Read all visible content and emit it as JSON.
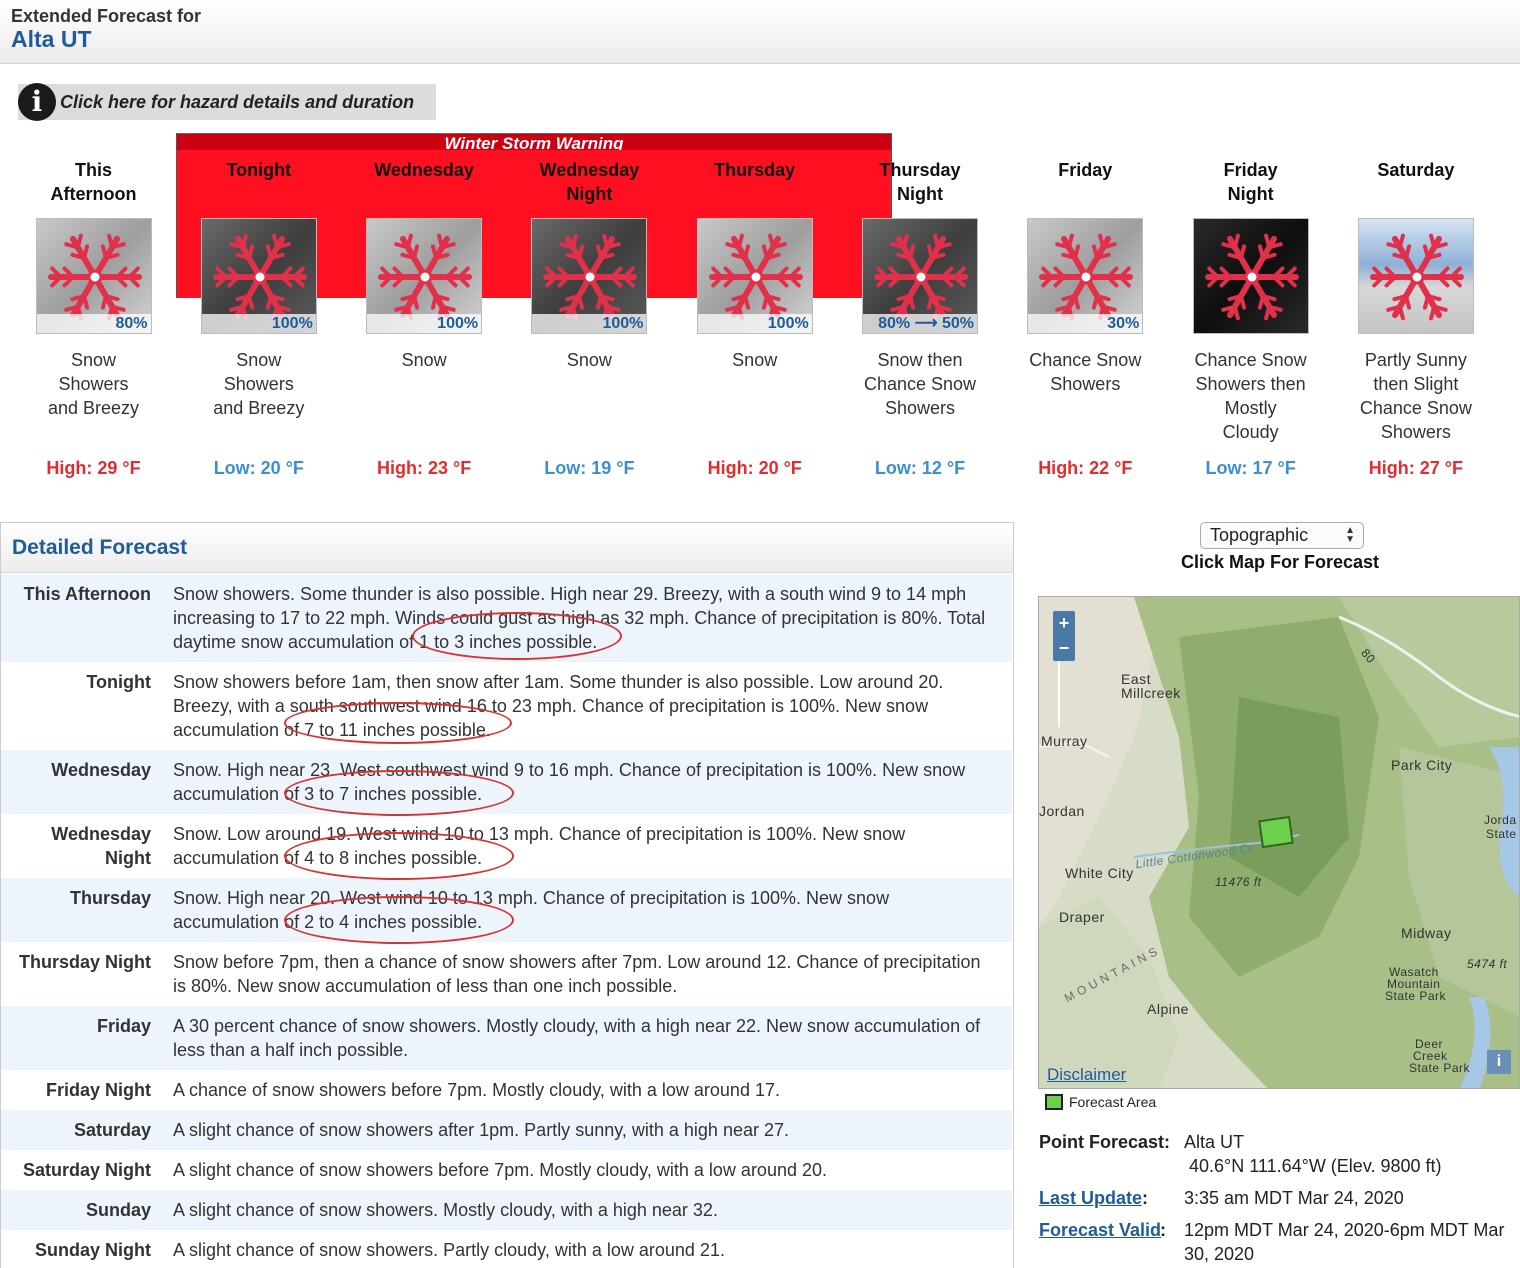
{
  "header": {
    "pre_title": "Extended Forecast for",
    "location": "Alta UT"
  },
  "hazard": {
    "icon": "info-icon",
    "label": "Click here for hazard details and duration"
  },
  "warning": {
    "label": "Winter Storm Warning",
    "color": "#ff0f1f"
  },
  "periods": [
    {
      "name_l1": "This",
      "name_l2": "Afternoon",
      "pop": "80%",
      "sky": "light",
      "desc": [
        "Snow",
        "Showers",
        "and Breezy",
        ""
      ],
      "temp": "High: 29 °F",
      "kind": "hi"
    },
    {
      "name_l1": "Tonight",
      "name_l2": "",
      "pop": "100%",
      "sky": "dark",
      "desc": [
        "Snow",
        "Showers",
        "and Breezy",
        ""
      ],
      "temp": "Low: 20 °F",
      "kind": "lo"
    },
    {
      "name_l1": "Wednesday",
      "name_l2": "",
      "pop": "100%",
      "sky": "light",
      "desc": [
        "Snow",
        "",
        "",
        ""
      ],
      "temp": "High: 23 °F",
      "kind": "hi"
    },
    {
      "name_l1": "Wednesday",
      "name_l2": "Night",
      "pop": "100%",
      "sky": "dark",
      "desc": [
        "Snow",
        "",
        "",
        ""
      ],
      "temp": "Low: 19 °F",
      "kind": "lo"
    },
    {
      "name_l1": "Thursday",
      "name_l2": "",
      "pop": "100%",
      "sky": "light",
      "desc": [
        "Snow",
        "",
        "",
        ""
      ],
      "temp": "High: 20 °F",
      "kind": "hi"
    },
    {
      "name_l1": "Thursday",
      "name_l2": "Night",
      "pop": "80% ⟶ 50%",
      "sky": "dark",
      "desc": [
        "Snow then",
        "Chance Snow",
        "Showers",
        ""
      ],
      "temp": "Low: 12 °F",
      "kind": "lo"
    },
    {
      "name_l1": "Friday",
      "name_l2": "",
      "pop": "30%",
      "sky": "light",
      "desc": [
        "Chance Snow",
        "Showers",
        "",
        ""
      ],
      "temp": "High: 22 °F",
      "kind": "hi"
    },
    {
      "name_l1": "Friday",
      "name_l2": "Night",
      "pop": "",
      "sky": "night",
      "desc": [
        "Chance Snow",
        "Showers then",
        "Mostly",
        "Cloudy"
      ],
      "temp": "Low: 17 °F",
      "kind": "lo"
    },
    {
      "name_l1": "Saturday",
      "name_l2": "",
      "pop": "",
      "sky": "sky",
      "desc": [
        "Partly Sunny",
        "then Slight",
        "Chance Snow",
        "Showers"
      ],
      "temp": "High: 27 °F",
      "kind": "hi"
    }
  ],
  "detailed": {
    "title": "Detailed Forecast",
    "rows": [
      {
        "label": [
          "This Afternoon"
        ],
        "lines": [
          "Snow showers. Some thunder is also possible. High near 29. Breezy, with a south wind 9 to 14 mph",
          "increasing to 17 to 22 mph. Winds could gust as high as 32 mph. Chance of precipitation is 80%. Total",
          "daytime snow accumulation of 1 to 3 inches possible."
        ]
      },
      {
        "label": [
          "Tonight"
        ],
        "lines": [
          "Snow showers before 1am, then snow after 1am. Some thunder is also possible. Low around 20.",
          "Breezy, with a south southwest wind 16 to 23 mph. Chance of precipitation is 100%. New snow",
          "accumulation of 7 to 11 inches possible."
        ]
      },
      {
        "label": [
          "Wednesday"
        ],
        "lines": [
          "Snow. High near 23. West southwest wind 9 to 16 mph. Chance of precipitation is 100%. New snow",
          "accumulation of 3 to 7 inches possible."
        ]
      },
      {
        "label": [
          "Wednesday",
          "Night"
        ],
        "lines": [
          "Snow. Low around 19. West wind 10 to 13 mph. Chance of precipitation is 100%. New snow",
          "accumulation of 4 to 8 inches possible."
        ]
      },
      {
        "label": [
          "Thursday"
        ],
        "lines": [
          "Snow. High near 20. West wind 10 to 13 mph. Chance of precipitation is 100%. New snow",
          "accumulation of 2 to 4 inches possible."
        ]
      },
      {
        "label": [
          "Thursday Night"
        ],
        "lines": [
          "Snow before 7pm, then a chance of snow showers after 7pm. Low around 12. Chance of precipitation",
          "is 80%. New snow accumulation of less than one inch possible."
        ]
      },
      {
        "label": [
          "Friday"
        ],
        "lines": [
          "A 30 percent chance of snow showers. Mostly cloudy, with a high near 22. New snow accumulation of",
          "less than a half inch possible."
        ]
      },
      {
        "label": [
          "Friday Night"
        ],
        "lines": [
          "A chance of snow showers before 7pm. Mostly cloudy, with a low around 17."
        ]
      },
      {
        "label": [
          "Saturday"
        ],
        "lines": [
          "A slight chance of snow showers after 1pm. Partly sunny, with a high near 27."
        ]
      },
      {
        "label": [
          "Saturday Night"
        ],
        "lines": [
          "A slight chance of snow showers before 7pm. Mostly cloudy, with a low around 20."
        ]
      },
      {
        "label": [
          "Sunday"
        ],
        "lines": [
          "A slight chance of snow showers. Mostly cloudy, with a high near 32."
        ]
      },
      {
        "label": [
          "Sunday Night"
        ],
        "lines": [
          "A slight chance of snow showers. Partly cloudy, with a low around 21."
        ]
      }
    ]
  },
  "map": {
    "select_value": "Topographic",
    "title": "Click Map For Forecast",
    "zoom_in": "+",
    "zoom_out": "−",
    "labels": {
      "east_millcreek_1": "East",
      "east_millcreek_2": "Millcreek",
      "murray": "Murray",
      "jordan": "Jordan",
      "white_city": "White City",
      "draper": "Draper",
      "alpine": "Alpine",
      "park_city": "Park City",
      "midway": "Midway",
      "wasatch_1": "Wasatch",
      "wasatch_2": "Mountain",
      "wasatch_3": "State Park",
      "deer_1": "Deer",
      "deer_2": "Creek",
      "deer_3": "State Park",
      "elev_11476": "11476 ft",
      "elev_5474": "5474 ft",
      "little_cottonwood": "Little Cottonwood Cr",
      "mountains": "MOUNTAINS",
      "road_80": "80",
      "jordanelle_1": "Jorda",
      "jordanelle_2": "State"
    },
    "disclaimer": "Disclaimer",
    "info_button": "i",
    "legend": "Forecast Area",
    "forecast_area_color": "#6ccf4e"
  },
  "point_forecast": {
    "label": "Point Forecast:",
    "name": "Alta UT",
    "coords": "40.6°N 111.64°W (Elev. 9800 ft)",
    "last_update_label": "Last Update",
    "last_update": "3:35 am MDT Mar 24, 2020",
    "valid_label": "Forecast Valid",
    "valid_l1": "12pm MDT Mar 24, 2020-6pm MDT Mar",
    "valid_l2": "30, 2020"
  }
}
